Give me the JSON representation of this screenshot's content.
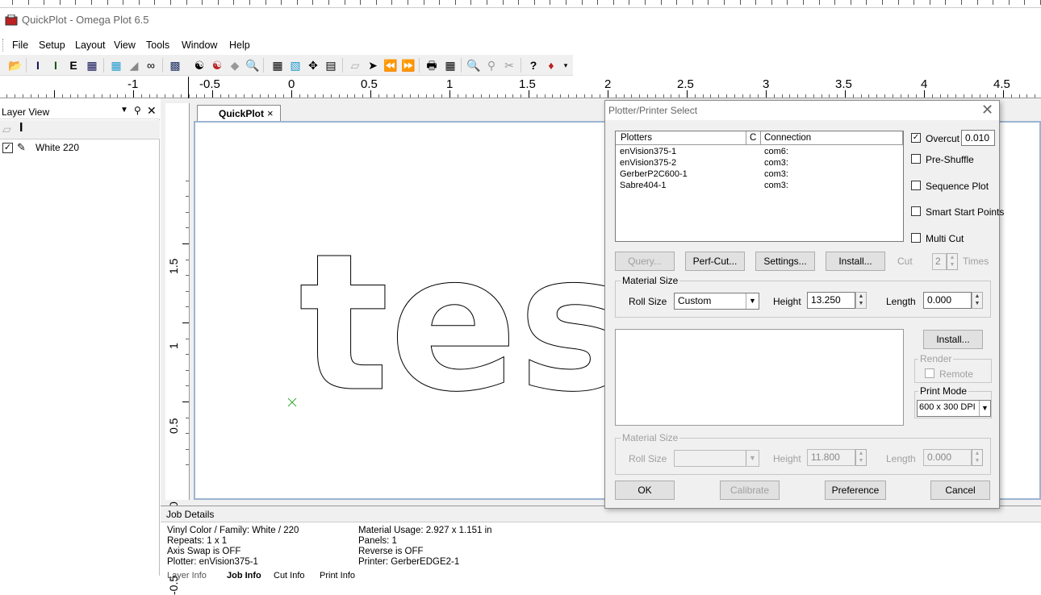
{
  "window": {
    "title": "QuickPlot - Omega Plot 6.5"
  },
  "menu": [
    "File",
    "Setup",
    "Layout",
    "View",
    "Tools",
    "Window",
    "Help"
  ],
  "toolbar_icons": [
    "open-icon",
    "import-icon",
    "text-icon",
    "fill-icon",
    "grid-icon",
    "select-icon",
    "print-icon",
    "zoom-icon",
    "help-icon"
  ],
  "ruler": {
    "h_labels": [
      "-1",
      "-0.5",
      "0",
      "0.5",
      "1",
      "1.5",
      "2",
      "2.5",
      "3",
      "3.5",
      "4",
      "4.5"
    ],
    "v_labels": [
      "1.5",
      "1",
      "0.5",
      "0",
      "-0.5"
    ]
  },
  "layer_view": {
    "title": "Layer View",
    "layers": [
      {
        "name": "White 220",
        "checked": true
      }
    ]
  },
  "document": {
    "tab_label": "QuickPlot",
    "close": "×",
    "canvas_text": "tes"
  },
  "job_details": {
    "title": "Job Details",
    "left": [
      "Vinyl Color / Family:  White / 220",
      "Repeats: 1 x 1",
      "Axis Swap is OFF",
      "Plotter: enVision375-1"
    ],
    "right": [
      "Material Usage: 2.927 x 1.151 in",
      "Panels:  1",
      "Reverse is OFF",
      "Printer: GerberEDGE2-1"
    ],
    "tabs": [
      "Layer Info",
      "Job Info",
      "Cut Info",
      "Print Info"
    ]
  },
  "dialog": {
    "title": "Plotter/Printer Select",
    "close": "✕",
    "plotters": {
      "headers": [
        "Plotters",
        "C",
        "Connection"
      ],
      "rows": [
        {
          "name": "enVision375-1",
          "conn": "com6:"
        },
        {
          "name": "enVision375-2",
          "conn": "com3:"
        },
        {
          "name": "GerberP2C600-1",
          "conn": "com3:"
        },
        {
          "name": "Sabre404-1",
          "conn": "com3:"
        }
      ]
    },
    "options": {
      "overcut": {
        "label": "Overcut",
        "checked": true,
        "value": "0.010"
      },
      "pre_shuffle": {
        "label": "Pre-Shuffle",
        "checked": false
      },
      "sequence_plot": {
        "label": "Sequence Plot",
        "checked": false
      },
      "smart_start": {
        "label": "Smart Start Points",
        "checked": false
      },
      "multi_cut": {
        "label": "Multi Cut",
        "checked": false
      }
    },
    "plotter_buttons": {
      "query": "Query...",
      "perf_cut": "Perf-Cut...",
      "settings": "Settings...",
      "install": "Install..."
    },
    "cut": {
      "label": "Cut",
      "value": "2",
      "times": "Times"
    },
    "material_plotter": {
      "title": "Material Size",
      "roll_size_label": "Roll Size",
      "roll_size": "Custom",
      "height_label": "Height",
      "height": "13.250",
      "length_label": "Length",
      "length": "0.000"
    },
    "printer": {
      "install": "Install...",
      "render_title": "Render",
      "remote_label": "Remote",
      "print_mode_title": "Print Mode",
      "print_mode": "600 x 300 DPI"
    },
    "material_printer": {
      "title": "Material Size",
      "roll_size_label": "Roll Size",
      "roll_size": "",
      "height_label": "Height",
      "height": "11.800",
      "length_label": "Length",
      "length": "0.000"
    },
    "buttons": {
      "ok": "OK",
      "calibrate": "Calibrate",
      "preference": "Preference",
      "cancel": "Cancel"
    }
  }
}
